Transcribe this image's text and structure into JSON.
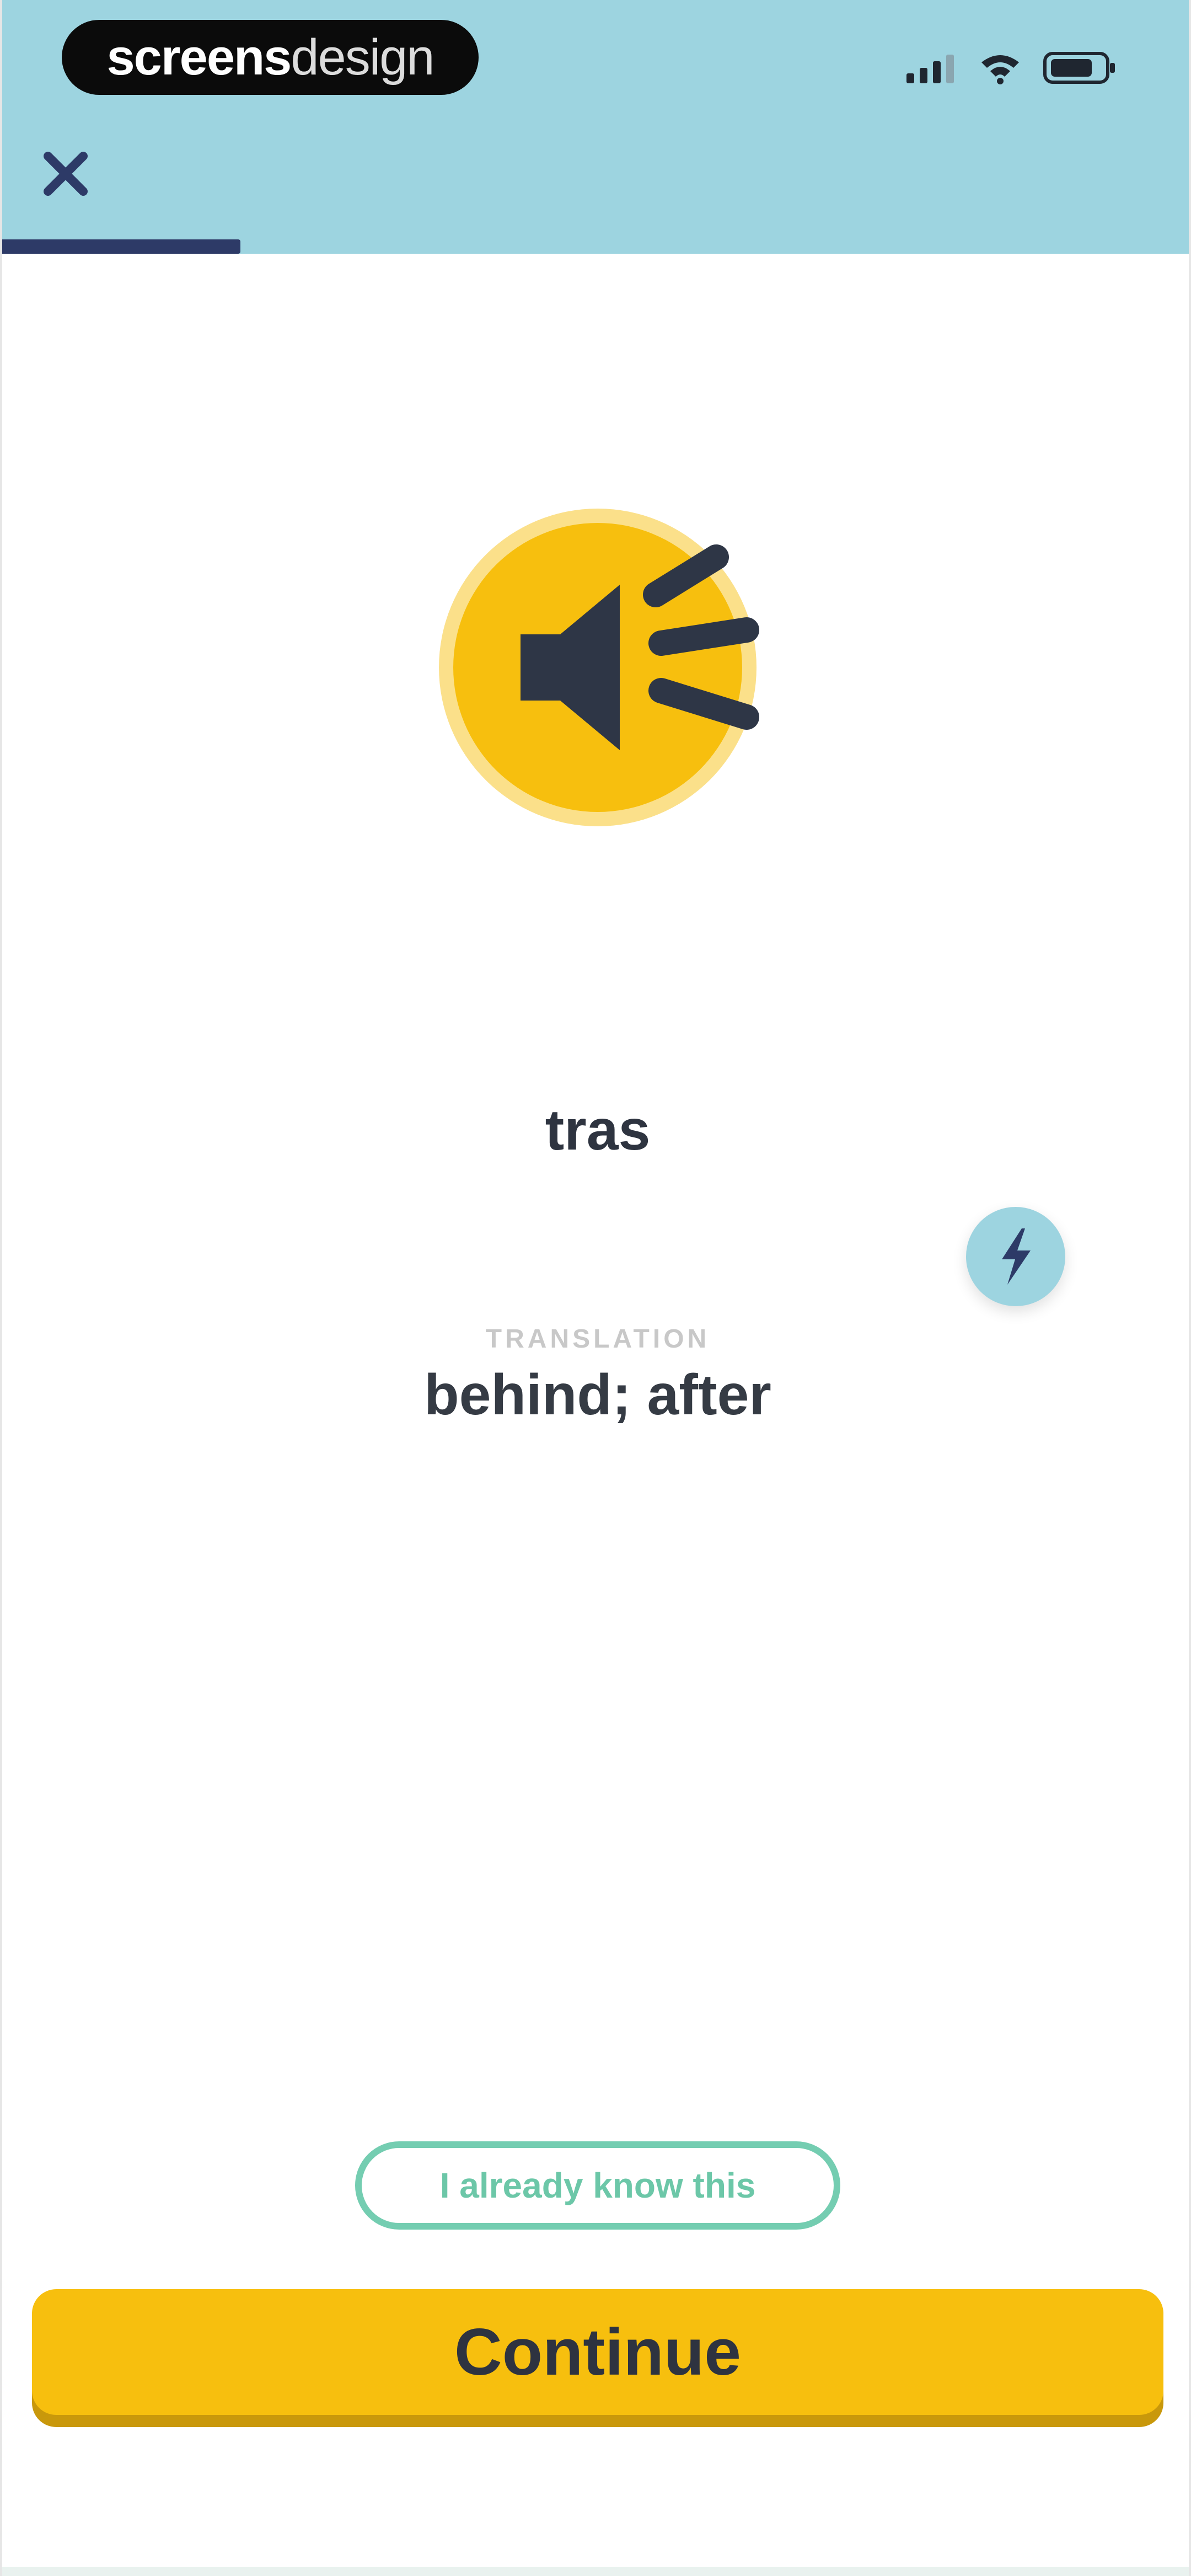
{
  "header": {
    "logo_left": "screens",
    "logo_right": "design",
    "progress_fraction": 0.2,
    "bg_color": "#9dd4e0",
    "progress_color": "#2d3a67"
  },
  "status_bar": {
    "icons": [
      "cellular-signal-icon",
      "wifi-icon",
      "battery-icon"
    ]
  },
  "toolbar": {
    "close_icon": "close-icon"
  },
  "card": {
    "audio_icon": "speaker-icon",
    "word": "tras",
    "translation_label": "TRANSLATION",
    "translation": "behind; after",
    "boost_icon": "lightning-bolt-icon"
  },
  "actions": {
    "already_know_label": "I already know this",
    "continue_label": "Continue"
  },
  "colors": {
    "accent_yellow": "#f7bf0e",
    "accent_green": "#74cdb1",
    "text_dark": "#2e3440"
  }
}
